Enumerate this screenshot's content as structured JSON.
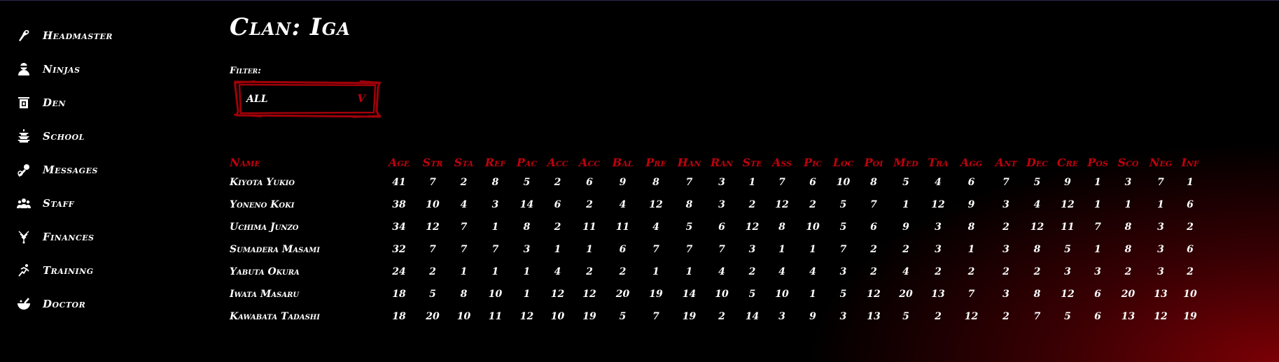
{
  "sidebar": {
    "items": [
      {
        "label": "Headmaster",
        "icon": "brush-icon"
      },
      {
        "label": "Ninjas",
        "icon": "ninja-icon"
      },
      {
        "label": "Den",
        "icon": "den-icon"
      },
      {
        "label": "School",
        "icon": "pagoda-icon"
      },
      {
        "label": "Messages",
        "icon": "messages-icon"
      },
      {
        "label": "Staff",
        "icon": "staff-icon"
      },
      {
        "label": "Finances",
        "icon": "finances-icon"
      },
      {
        "label": "Training",
        "icon": "training-icon"
      },
      {
        "label": "Doctor",
        "icon": "mortar-icon"
      }
    ]
  },
  "page": {
    "title": "Clan: Iga"
  },
  "filter": {
    "label": "Filter:",
    "value": "ALL",
    "caret": "V"
  },
  "colors": {
    "accent": "#c0000d",
    "background": "#000000",
    "text": "#ffffff"
  },
  "table": {
    "headers": [
      "Name",
      "Age",
      "Str",
      "Sta",
      "Ref",
      "Pac",
      "Acc",
      "Acc",
      "Bal",
      "Pre",
      "Han",
      "Ran",
      "Ste",
      "Ass",
      "Pic",
      "Loc",
      "Poi",
      "Med",
      "Tra",
      "Agg",
      "Ant",
      "Dec",
      "Cre",
      "Pos",
      "Sco",
      "Neg",
      "Inf"
    ],
    "rows": [
      [
        "Kiyota Yukio",
        "41",
        "7",
        "2",
        "8",
        "5",
        "2",
        "6",
        "9",
        "8",
        "7",
        "3",
        "1",
        "7",
        "6",
        "10",
        "8",
        "5",
        "4",
        "6",
        "7",
        "5",
        "9",
        "1",
        "3",
        "7",
        "1"
      ],
      [
        "Yoneno Koki",
        "38",
        "10",
        "4",
        "3",
        "14",
        "6",
        "2",
        "4",
        "12",
        "8",
        "3",
        "2",
        "12",
        "2",
        "5",
        "7",
        "1",
        "12",
        "9",
        "3",
        "4",
        "12",
        "1",
        "1",
        "1",
        "6"
      ],
      [
        "Uchima Junzo",
        "34",
        "12",
        "7",
        "1",
        "8",
        "2",
        "11",
        "11",
        "4",
        "5",
        "6",
        "12",
        "8",
        "10",
        "5",
        "6",
        "9",
        "3",
        "8",
        "2",
        "12",
        "11",
        "7",
        "8",
        "3",
        "2"
      ],
      [
        "Sumadera Masami",
        "32",
        "7",
        "7",
        "7",
        "3",
        "1",
        "1",
        "6",
        "7",
        "7",
        "7",
        "3",
        "1",
        "1",
        "7",
        "2",
        "2",
        "3",
        "1",
        "3",
        "8",
        "5",
        "1",
        "8",
        "3",
        "6"
      ],
      [
        "Yabuta Okura",
        "24",
        "2",
        "1",
        "1",
        "1",
        "4",
        "2",
        "2",
        "1",
        "1",
        "4",
        "2",
        "4",
        "4",
        "3",
        "2",
        "4",
        "2",
        "2",
        "2",
        "2",
        "3",
        "3",
        "2",
        "3",
        "2"
      ],
      [
        "Iwata Masaru",
        "18",
        "5",
        "8",
        "10",
        "1",
        "12",
        "12",
        "20",
        "19",
        "14",
        "10",
        "5",
        "10",
        "1",
        "5",
        "12",
        "20",
        "13",
        "7",
        "3",
        "8",
        "12",
        "6",
        "20",
        "13",
        "10"
      ],
      [
        "Kawabata Tadashi",
        "18",
        "20",
        "10",
        "11",
        "12",
        "10",
        "19",
        "5",
        "7",
        "19",
        "2",
        "14",
        "3",
        "9",
        "3",
        "13",
        "5",
        "2",
        "12",
        "2",
        "7",
        "5",
        "6",
        "13",
        "12",
        "19"
      ]
    ]
  }
}
